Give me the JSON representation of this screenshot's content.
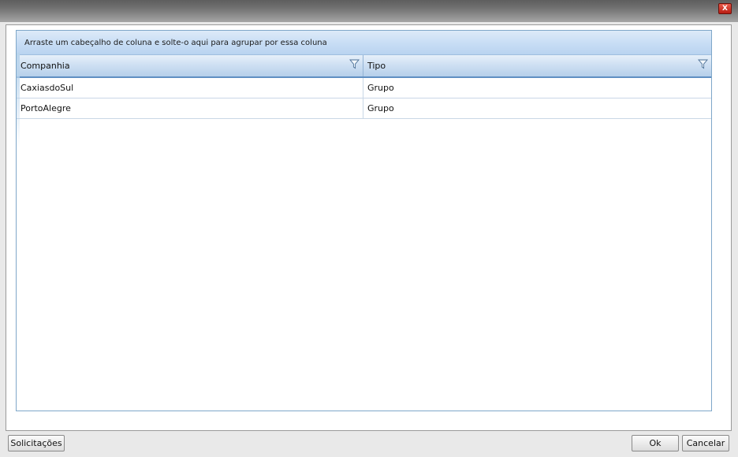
{
  "window": {
    "close_label": "X"
  },
  "grid": {
    "group_panel_text": "Arraste um cabeçalho de coluna e solte-o aqui para agrupar por essa coluna",
    "columns": [
      {
        "label": "Companhia",
        "icon": "filter-icon"
      },
      {
        "label": "Tipo",
        "icon": "filter-icon"
      }
    ],
    "rows": [
      {
        "companhia": "CaxiasdoSul",
        "tipo": "Grupo"
      },
      {
        "companhia": "PortoAlegre",
        "tipo": "Grupo"
      }
    ]
  },
  "footer": {
    "solicitacoes_label": "Solicitações",
    "ok_label": "Ok",
    "cancel_label": "Cancelar"
  },
  "colors": {
    "accent_border": "#7fa7c9",
    "header_bottom": "#5f8fc2",
    "close_red": "#c8281c"
  }
}
